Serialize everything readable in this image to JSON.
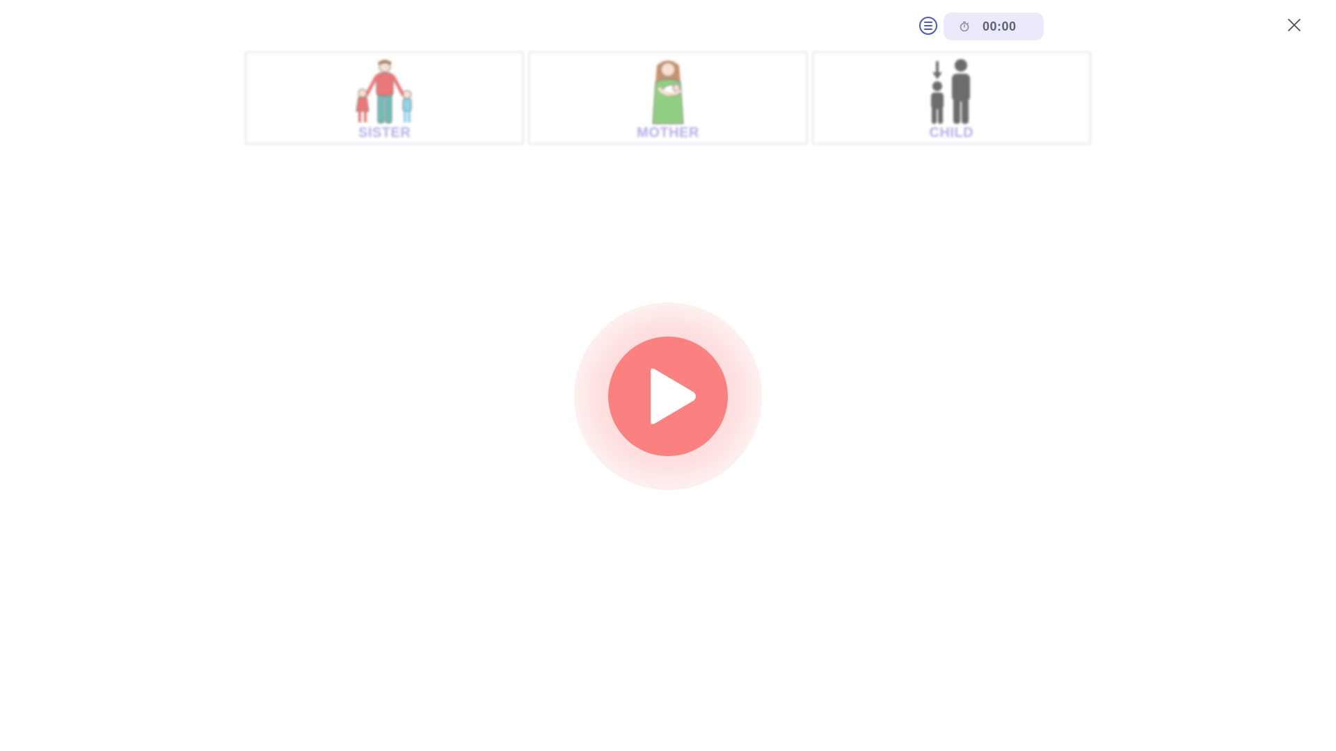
{
  "header": {
    "timer": "00:00",
    "menu_icon": "list-menu-icon",
    "stopwatch_icon": "stopwatch-icon",
    "close_icon": "close-icon"
  },
  "cards": [
    {
      "label": "SISTER",
      "icon": "family-group-icon"
    },
    {
      "label": "MOTHER",
      "icon": "mother-with-baby-icon"
    },
    {
      "label": "CHILD",
      "icon": "child-adult-icon"
    }
  ],
  "play": {
    "icon": "play-icon"
  },
  "colors": {
    "accent": "#4a55c6",
    "label": "#9c97de",
    "play": "#fb8080",
    "timer_bg": "#eceafa"
  }
}
